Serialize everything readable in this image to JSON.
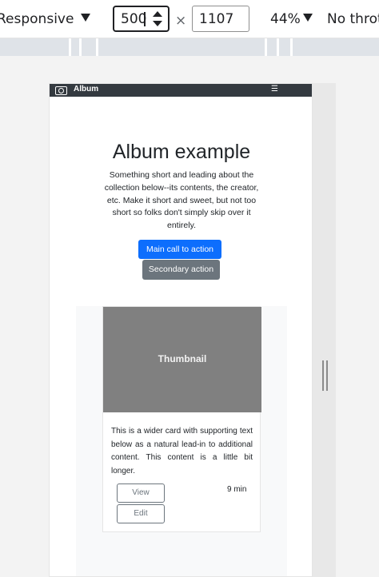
{
  "devtools": {
    "device_label": "Responsive",
    "width_value": "500",
    "times_symbol": "×",
    "height_value": "1107",
    "zoom_label": "44%",
    "throttle_label": "No throt"
  },
  "site": {
    "brand": "Album",
    "hero_title": "Album example",
    "hero_lead": "Something short and leading about the collection below--its contents, the creator, etc. Make it short and sweet, but not too short so folks don't simply skip over it entirely.",
    "primary_cta": "Main call to action",
    "secondary_cta": "Secondary action",
    "card": {
      "thumbnail_label": "Thumbnail",
      "text": "This is a wider card with supporting text below as a natural lead-in to additional content. This content is a little bit longer.",
      "view_label": "View",
      "edit_label": "Edit",
      "time_label": "9 min"
    }
  },
  "colors": {
    "navbar": "#343a40",
    "primary": "#0d6efd",
    "secondary": "#6c757d",
    "thumbnail": "#808080"
  },
  "icons": [
    "camera-icon",
    "hamburger-menu-icon",
    "dropdown-arrow-icon",
    "spin-up-icon",
    "spin-down-icon",
    "resize-handle-icon"
  ]
}
